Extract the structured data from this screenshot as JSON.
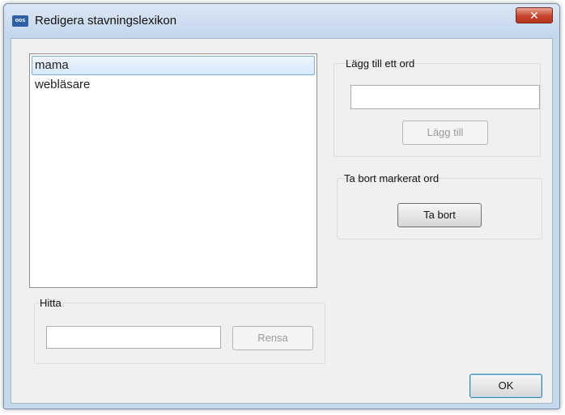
{
  "window": {
    "title": "Redigera stavningslexikon",
    "app_icon_text": "oos",
    "close_symbol": "✕"
  },
  "wordlist": {
    "items": [
      {
        "label": "mama",
        "selected": true
      },
      {
        "label": "webläsare",
        "selected": false
      }
    ]
  },
  "add_word": {
    "group_title": "Lägg till ett ord",
    "input_value": "",
    "button_label": "Lägg till"
  },
  "remove_word": {
    "group_title": "Ta bort markerat ord",
    "button_label": "Ta bort"
  },
  "find": {
    "group_title": "Hitta",
    "input_value": "",
    "clear_label": "Rensa"
  },
  "footer": {
    "ok_label": "OK"
  }
}
